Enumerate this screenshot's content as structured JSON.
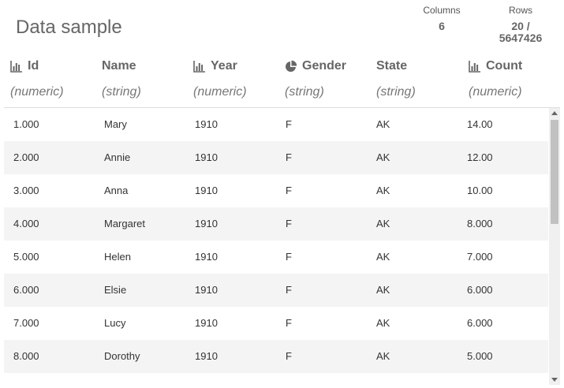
{
  "title": "Data sample",
  "stats": {
    "columns_label": "Columns",
    "columns_value": "6",
    "rows_label": "Rows",
    "rows_value_line1": "20 /",
    "rows_value_line2": "5647426"
  },
  "columns": [
    {
      "name": "Id",
      "type": "(numeric)",
      "icon": "bar-chart-icon"
    },
    {
      "name": "Name",
      "type": "(string)",
      "icon": ""
    },
    {
      "name": "Year",
      "type": "(numeric)",
      "icon": "bar-chart-icon"
    },
    {
      "name": "Gender",
      "type": "(string)",
      "icon": "pie-chart-icon"
    },
    {
      "name": "State",
      "type": "(string)",
      "icon": ""
    },
    {
      "name": "Count",
      "type": "(numeric)",
      "icon": "bar-chart-icon"
    }
  ],
  "rows": [
    [
      "1.000",
      "Mary",
      "1910",
      "F",
      "AK",
      "14.00"
    ],
    [
      "2.000",
      "Annie",
      "1910",
      "F",
      "AK",
      "12.00"
    ],
    [
      "3.000",
      "Anna",
      "1910",
      "F",
      "AK",
      "10.00"
    ],
    [
      "4.000",
      "Margaret",
      "1910",
      "F",
      "AK",
      "8.000"
    ],
    [
      "5.000",
      "Helen",
      "1910",
      "F",
      "AK",
      "7.000"
    ],
    [
      "6.000",
      "Elsie",
      "1910",
      "F",
      "AK",
      "6.000"
    ],
    [
      "7.000",
      "Lucy",
      "1910",
      "F",
      "AK",
      "6.000"
    ],
    [
      "8.000",
      "Dorothy",
      "1910",
      "F",
      "AK",
      "5.000"
    ]
  ],
  "colors": {
    "stripe": "#f4f4f4",
    "icon": "#666666"
  }
}
